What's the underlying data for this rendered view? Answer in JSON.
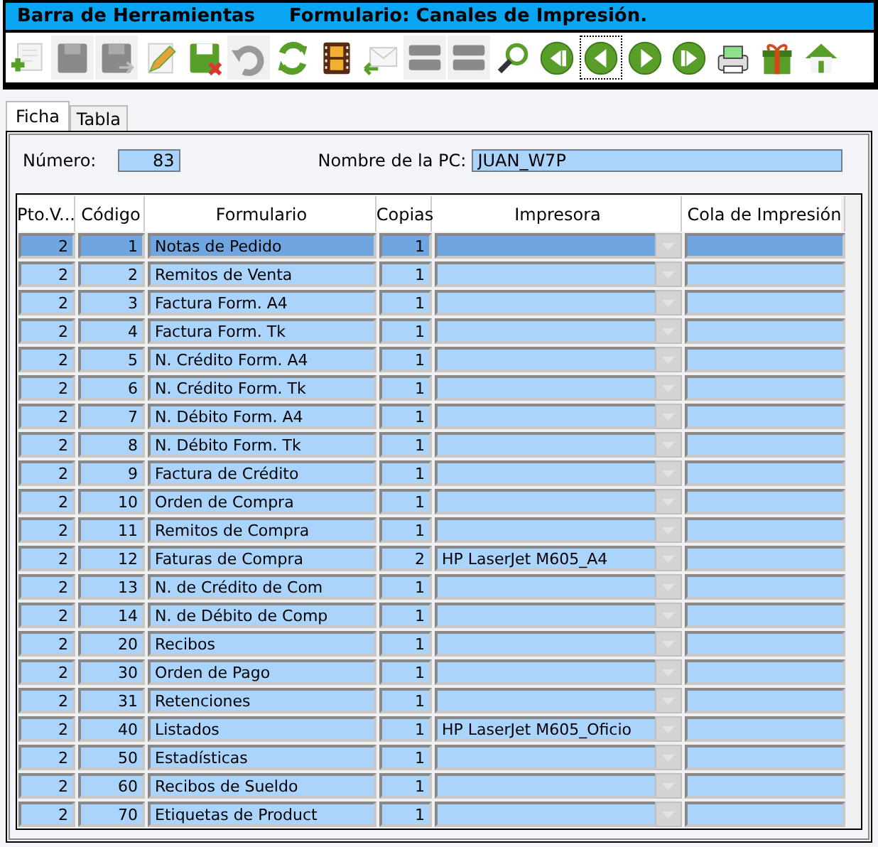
{
  "title_bar": {
    "left": "Barra de Herramientas",
    "right": "Formulario: Canales de Impresión."
  },
  "toolbar": [
    {
      "kind": "new",
      "disabled": false,
      "focused": false
    },
    {
      "kind": "save",
      "disabled": true,
      "focused": false
    },
    {
      "kind": "save-as",
      "disabled": true,
      "focused": false
    },
    {
      "kind": "edit",
      "disabled": false,
      "focused": false
    },
    {
      "kind": "save-delete",
      "disabled": false,
      "focused": false
    },
    {
      "kind": "undo",
      "disabled": true,
      "focused": false
    },
    {
      "kind": "refresh",
      "disabled": false,
      "focused": false
    },
    {
      "kind": "film",
      "disabled": false,
      "focused": false
    },
    {
      "kind": "mail-back",
      "disabled": false,
      "focused": false
    },
    {
      "kind": "list",
      "disabled": true,
      "focused": false
    },
    {
      "kind": "list",
      "disabled": true,
      "focused": false
    },
    {
      "kind": "search",
      "disabled": false,
      "focused": false
    },
    {
      "kind": "first",
      "disabled": false,
      "focused": false
    },
    {
      "kind": "prev",
      "disabled": false,
      "focused": true
    },
    {
      "kind": "next",
      "disabled": false,
      "focused": false
    },
    {
      "kind": "last",
      "disabled": false,
      "focused": false
    },
    {
      "kind": "printer",
      "disabled": false,
      "focused": false
    },
    {
      "kind": "gift",
      "disabled": false,
      "focused": false
    },
    {
      "kind": "home",
      "disabled": false,
      "focused": false
    }
  ],
  "tabs": [
    {
      "label": "Ficha",
      "selected": true
    },
    {
      "label": "Tabla",
      "selected": false
    }
  ],
  "numero": {
    "label": "Número:",
    "value": "83"
  },
  "pc": {
    "label": "Nombre de la PC:",
    "value": "JUAN_W7P"
  },
  "table": {
    "columns": [
      "Pto.V...",
      "Código",
      "Formulario",
      "Copias",
      "Impresora",
      "Cola de Impresión"
    ],
    "rows": [
      {
        "pto": "2",
        "codigo": "1",
        "formulario": "Notas de Pedido",
        "copias": "1",
        "selected": true
      },
      {
        "pto": "2",
        "codigo": "2",
        "formulario": "Remitos de Venta",
        "copias": "1",
        "selected": false
      },
      {
        "pto": "2",
        "codigo": "3",
        "formulario": "Factura Form. A4",
        "copias": "1",
        "selected": false
      },
      {
        "pto": "2",
        "codigo": "4",
        "formulario": "Factura Form. Tk",
        "copias": "1",
        "selected": false
      },
      {
        "pto": "2",
        "codigo": "5",
        "formulario": "N. Crédito Form. A4",
        "copias": "1",
        "selected": false
      },
      {
        "pto": "2",
        "codigo": "6",
        "formulario": "N. Crédito Form. Tk",
        "copias": "1",
        "selected": false
      },
      {
        "pto": "2",
        "codigo": "7",
        "formulario": "N. Débito Form. A4",
        "copias": "1",
        "selected": false
      },
      {
        "pto": "2",
        "codigo": "8",
        "formulario": "N. Débito Form. Tk",
        "copias": "1",
        "selected": false
      },
      {
        "pto": "2",
        "codigo": "9",
        "formulario": "Factura de Crédito",
        "copias": "1",
        "selected": false
      },
      {
        "pto": "2",
        "codigo": "10",
        "formulario": "Orden de Compra",
        "copias": "1",
        "selected": false
      },
      {
        "pto": "2",
        "codigo": "11",
        "formulario": "Remitos de Compra",
        "copias": "1",
        "selected": false
      },
      {
        "pto": "2",
        "codigo": "12",
        "formulario": "Faturas de Compra",
        "copias": "2",
        "impresora": "HP LaserJet M605_A4",
        "selected": false
      },
      {
        "pto": "2",
        "codigo": "13",
        "formulario": "N. de Crédito de Com",
        "copias": "1",
        "selected": false
      },
      {
        "pto": "2",
        "codigo": "14",
        "formulario": "N. de Débito de Comp",
        "copias": "1",
        "selected": false
      },
      {
        "pto": "2",
        "codigo": "20",
        "formulario": "Recibos",
        "copias": "1",
        "selected": false
      },
      {
        "pto": "2",
        "codigo": "30",
        "formulario": "Orden de Pago",
        "copias": "1",
        "selected": false
      },
      {
        "pto": "2",
        "codigo": "31",
        "formulario": "Retenciones",
        "copias": "1",
        "selected": false
      },
      {
        "pto": "2",
        "codigo": "40",
        "formulario": "Listados",
        "copias": "1",
        "impresora": "HP LaserJet M605_Oficio",
        "selected": false
      },
      {
        "pto": "2",
        "codigo": "50",
        "formulario": "Estadísticas",
        "copias": "1",
        "selected": false
      },
      {
        "pto": "2",
        "codigo": "60",
        "formulario": "Recibos de Sueldo",
        "copias": "1",
        "selected": false
      },
      {
        "pto": "2",
        "codigo": "70",
        "formulario": "Etiquetas de Product",
        "copias": "1",
        "selected": false
      }
    ]
  }
}
